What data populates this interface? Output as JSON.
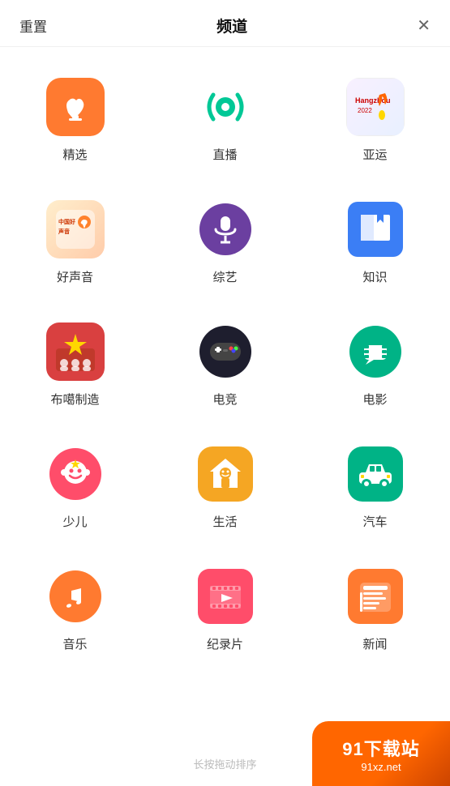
{
  "header": {
    "reset_label": "重置",
    "title": "频道",
    "close_icon": "✕"
  },
  "channels": [
    {
      "id": "jingxuan",
      "label": "精选",
      "icon_type": "jingxuan"
    },
    {
      "id": "zhibao",
      "label": "直播",
      "icon_type": "zhibao"
    },
    {
      "id": "ayun",
      "label": "亚运",
      "icon_type": "ayun"
    },
    {
      "id": "haoshengyin",
      "label": "好声音",
      "icon_type": "haoshengyin"
    },
    {
      "id": "zongyi",
      "label": "综艺",
      "icon_type": "zongyi"
    },
    {
      "id": "zhishi",
      "label": "知识",
      "icon_type": "zhishi"
    },
    {
      "id": "buchang",
      "label": "布噶制造",
      "icon_type": "buchang"
    },
    {
      "id": "dianjing",
      "label": "电竞",
      "icon_type": "dianjing"
    },
    {
      "id": "dianying",
      "label": "电影",
      "icon_type": "dianying"
    },
    {
      "id": "shaoer",
      "label": "少儿",
      "icon_type": "shaoer"
    },
    {
      "id": "shenghuo",
      "label": "生活",
      "icon_type": "shenghuo"
    },
    {
      "id": "qiche",
      "label": "汽车",
      "icon_type": "qiche"
    },
    {
      "id": "yinyue",
      "label": "音乐",
      "icon_type": "yinyue"
    },
    {
      "id": "jilupian",
      "label": "纪录片",
      "icon_type": "jilupian"
    },
    {
      "id": "xinwen",
      "label": "新闻",
      "icon_type": "xinwen"
    }
  ],
  "footer": {
    "hint": "长按拖动排序"
  },
  "watermark": {
    "line1": "91下载站",
    "line2": "91xz.net"
  }
}
